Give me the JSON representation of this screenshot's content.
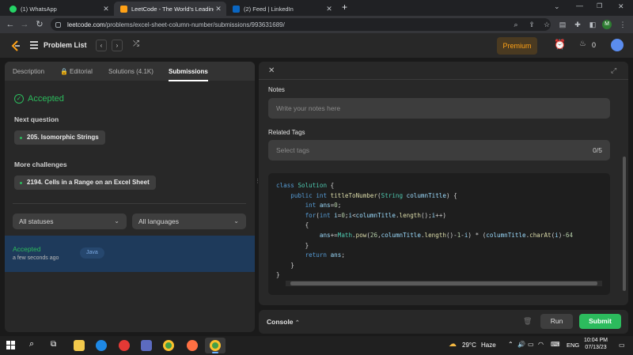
{
  "browser": {
    "tabs": [
      {
        "title": "(1) WhatsApp",
        "active": false
      },
      {
        "title": "LeetCode - The World's Leading",
        "active": true
      },
      {
        "title": "(2) Feed | LinkedIn",
        "active": false
      }
    ],
    "new_tab": "+",
    "url_host": "leetcode.com",
    "url_path": "/problems/excel-sheet-column-number/submissions/993631689/",
    "profile_initial": "M"
  },
  "lcnav": {
    "problem_list": "Problem List",
    "premium": "Premium",
    "streak_count": "0"
  },
  "left": {
    "tabs": {
      "description": "Description",
      "editorial": "Editorial",
      "solutions": "Solutions (4.1K)",
      "submissions": "Submissions"
    },
    "status": "Accepted",
    "next_question_label": "Next question",
    "next_question": "205. Isomorphic Strings",
    "more_challenges_label": "More challenges",
    "more_challenge": "2194. Cells in a Range on an Excel Sheet",
    "filter_status": "All statuses",
    "filter_language": "All languages",
    "submission": {
      "status": "Accepted",
      "time": "a few seconds ago",
      "language": "Java"
    }
  },
  "right": {
    "notes_label": "Notes",
    "notes_placeholder": "Write your notes here",
    "tags_label": "Related Tags",
    "tags_placeholder": "Select tags",
    "tags_count": "0/5"
  },
  "console": {
    "label": "Console",
    "run": "Run",
    "submit": "Submit"
  },
  "taskbar": {
    "temperature": "29°C",
    "weather": "Haze",
    "lang": "ENG",
    "time": "10:04 PM",
    "date": "07/13/23"
  },
  "colors": {
    "accent_green": "#2cbb5d",
    "premium": "#ffa116",
    "lc_orange": "#ffa116"
  }
}
